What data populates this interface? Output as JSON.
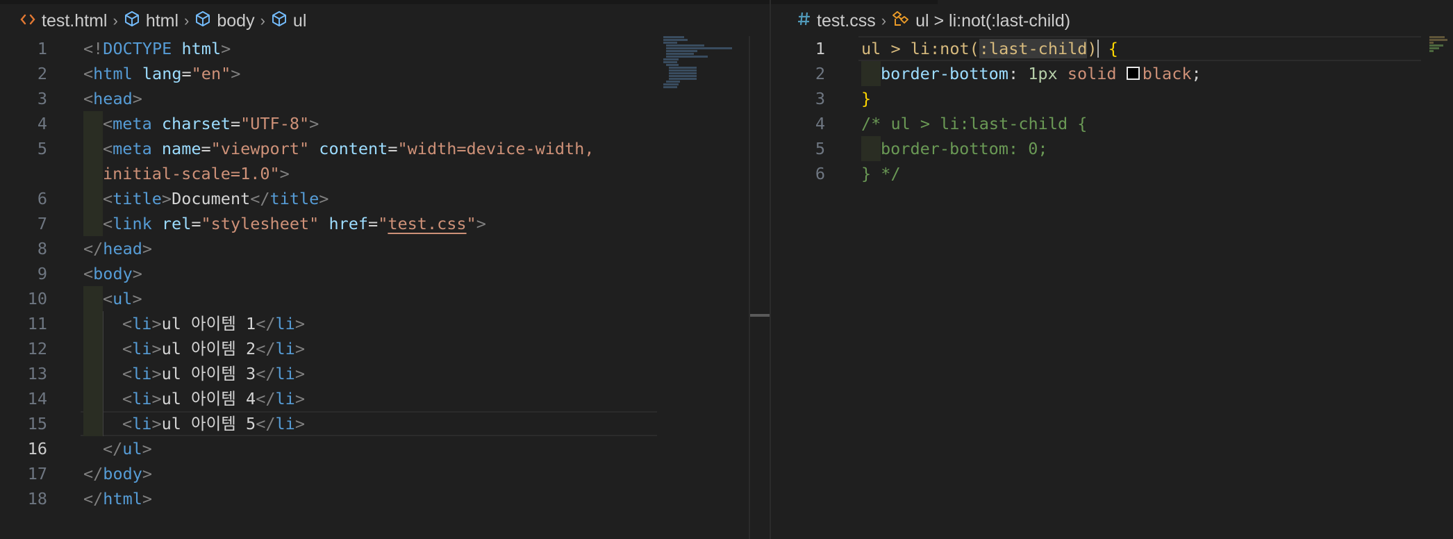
{
  "left_pane": {
    "breadcrumb": [
      {
        "label": "test.html",
        "icon": "html-file-icon"
      },
      {
        "label": "html",
        "icon": "element-icon"
      },
      {
        "label": "body",
        "icon": "element-icon"
      },
      {
        "label": "ul",
        "icon": "element-icon"
      }
    ],
    "active_line": "16",
    "lines": [
      {
        "n": "1",
        "tokens": [
          [
            "t",
            "<!"
          ],
          [
            "tn",
            "DOCTYPE"
          ],
          [
            "pn",
            " "
          ],
          [
            "an",
            "html"
          ],
          [
            "t",
            ">"
          ]
        ]
      },
      {
        "n": "2",
        "tokens": [
          [
            "t",
            "<"
          ],
          [
            "tn",
            "html"
          ],
          [
            "pn",
            " "
          ],
          [
            "an",
            "lang"
          ],
          [
            "pn",
            "="
          ],
          [
            "av",
            "\"en\""
          ],
          [
            "t",
            ">"
          ]
        ]
      },
      {
        "n": "3",
        "tokens": [
          [
            "t",
            "<"
          ],
          [
            "tn",
            "head"
          ],
          [
            "t",
            ">"
          ]
        ]
      },
      {
        "n": "4",
        "tokens": [
          [
            "t",
            "<"
          ],
          [
            "tn",
            "meta"
          ],
          [
            "pn",
            " "
          ],
          [
            "an",
            "charset"
          ],
          [
            "pn",
            "="
          ],
          [
            "av",
            "\"UTF-8\""
          ],
          [
            "t",
            ">"
          ]
        ]
      },
      {
        "n": "5",
        "tokens": [
          [
            "t",
            "<"
          ],
          [
            "tn",
            "meta"
          ],
          [
            "pn",
            " "
          ],
          [
            "an",
            "name"
          ],
          [
            "pn",
            "="
          ],
          [
            "av",
            "\"viewport\""
          ],
          [
            "pn",
            " "
          ],
          [
            "an",
            "content"
          ],
          [
            "pn",
            "="
          ],
          [
            "av",
            "\"width=device-width,"
          ]
        ]
      },
      {
        "n": "",
        "tokens": [
          [
            "av",
            "initial-scale=1.0\""
          ],
          [
            "t",
            ">"
          ]
        ]
      },
      {
        "n": "6",
        "tokens": [
          [
            "t",
            "<"
          ],
          [
            "tn",
            "title"
          ],
          [
            "t",
            ">"
          ],
          [
            "tx",
            "Document"
          ],
          [
            "t",
            "</"
          ],
          [
            "tn",
            "title"
          ],
          [
            "t",
            ">"
          ]
        ]
      },
      {
        "n": "7",
        "tokens": [
          [
            "t",
            "<"
          ],
          [
            "tn",
            "link"
          ],
          [
            "pn",
            " "
          ],
          [
            "an",
            "rel"
          ],
          [
            "pn",
            "="
          ],
          [
            "av",
            "\"stylesheet\""
          ],
          [
            "pn",
            " "
          ],
          [
            "an",
            "href"
          ],
          [
            "pn",
            "="
          ],
          [
            "av",
            "\""
          ],
          [
            "av link",
            "test.css"
          ],
          [
            "av",
            "\""
          ],
          [
            "t",
            ">"
          ]
        ]
      },
      {
        "n": "8",
        "tokens": [
          [
            "t",
            "</"
          ],
          [
            "tn",
            "head"
          ],
          [
            "t",
            ">"
          ]
        ]
      },
      {
        "n": "9",
        "tokens": [
          [
            "t",
            "<"
          ],
          [
            "tn",
            "body"
          ],
          [
            "t",
            ">"
          ]
        ]
      },
      {
        "n": "10",
        "tokens": [
          [
            "t",
            "<"
          ],
          [
            "tn",
            "ul"
          ],
          [
            "t",
            ">"
          ]
        ]
      },
      {
        "n": "11",
        "tokens": [
          [
            "t",
            "<"
          ],
          [
            "tn",
            "li"
          ],
          [
            "t",
            ">"
          ],
          [
            "tx",
            "ul 아이템 1"
          ],
          [
            "t",
            "</"
          ],
          [
            "tn",
            "li"
          ],
          [
            "t",
            ">"
          ]
        ]
      },
      {
        "n": "12",
        "tokens": [
          [
            "t",
            "<"
          ],
          [
            "tn",
            "li"
          ],
          [
            "t",
            ">"
          ],
          [
            "tx",
            "ul 아이템 2"
          ],
          [
            "t",
            "</"
          ],
          [
            "tn",
            "li"
          ],
          [
            "t",
            ">"
          ]
        ]
      },
      {
        "n": "13",
        "tokens": [
          [
            "t",
            "<"
          ],
          [
            "tn",
            "li"
          ],
          [
            "t",
            ">"
          ],
          [
            "tx",
            "ul 아이템 3"
          ],
          [
            "t",
            "</"
          ],
          [
            "tn",
            "li"
          ],
          [
            "t",
            ">"
          ]
        ]
      },
      {
        "n": "14",
        "tokens": [
          [
            "t",
            "<"
          ],
          [
            "tn",
            "li"
          ],
          [
            "t",
            ">"
          ],
          [
            "tx",
            "ul 아이템 4"
          ],
          [
            "t",
            "</"
          ],
          [
            "tn",
            "li"
          ],
          [
            "t",
            ">"
          ]
        ]
      },
      {
        "n": "15",
        "tokens": [
          [
            "t",
            "<"
          ],
          [
            "tn",
            "li"
          ],
          [
            "t",
            ">"
          ],
          [
            "tx",
            "ul 아이템 5"
          ],
          [
            "t",
            "</"
          ],
          [
            "tn",
            "li"
          ],
          [
            "t",
            ">"
          ]
        ]
      },
      {
        "n": "16",
        "tokens": [
          [
            "t",
            "</"
          ],
          [
            "tn",
            "ul"
          ],
          [
            "t",
            ">"
          ]
        ]
      },
      {
        "n": "17",
        "tokens": [
          [
            "t",
            "</"
          ],
          [
            "tn",
            "body"
          ],
          [
            "t",
            ">"
          ]
        ]
      },
      {
        "n": "18",
        "tokens": [
          [
            "t",
            "</"
          ],
          [
            "tn",
            "html"
          ],
          [
            "t",
            ">"
          ]
        ]
      }
    ]
  },
  "right_pane": {
    "breadcrumb": [
      {
        "label": "test.css",
        "icon": "hash-icon"
      },
      {
        "label": "ul > li:not(:last-child)",
        "icon": "selector-icon"
      }
    ],
    "active_line": "1",
    "lines": [
      {
        "n": "1",
        "tokens": [
          [
            "sel",
            "ul > li:not("
          ],
          [
            "sel hl",
            ":last-child"
          ],
          [
            "sel",
            ")"
          ],
          [
            "cursor",
            ""
          ],
          [
            "pn",
            " "
          ],
          [
            "br",
            "{"
          ]
        ]
      },
      {
        "n": "2",
        "tokens": [
          [
            "pr",
            "border-bottom"
          ],
          [
            "pn",
            ": "
          ],
          [
            "num",
            "1px"
          ],
          [
            "pn",
            " "
          ],
          [
            "kw",
            "solid"
          ],
          [
            "pn",
            " "
          ],
          [
            "swatch",
            ""
          ],
          [
            "kw",
            "black"
          ],
          [
            "pn",
            ";"
          ]
        ]
      },
      {
        "n": "3",
        "tokens": [
          [
            "br",
            "}"
          ]
        ]
      },
      {
        "n": "4",
        "tokens": [
          [
            "cm",
            "/* ul > li:last-child {"
          ]
        ]
      },
      {
        "n": "5",
        "tokens": [
          [
            "cm",
            "border-bottom: 0;"
          ]
        ]
      },
      {
        "n": "6",
        "tokens": [
          [
            "cm",
            "} */"
          ]
        ]
      }
    ]
  },
  "colors": {
    "background": "#1f1f1f",
    "tag": "#569cd6",
    "attribute": "#9cdcfe",
    "string": "#ce9178",
    "selector": "#d7ba7d",
    "comment": "#6a9955",
    "number": "#b5cea8",
    "bracket": "#ffd700"
  }
}
